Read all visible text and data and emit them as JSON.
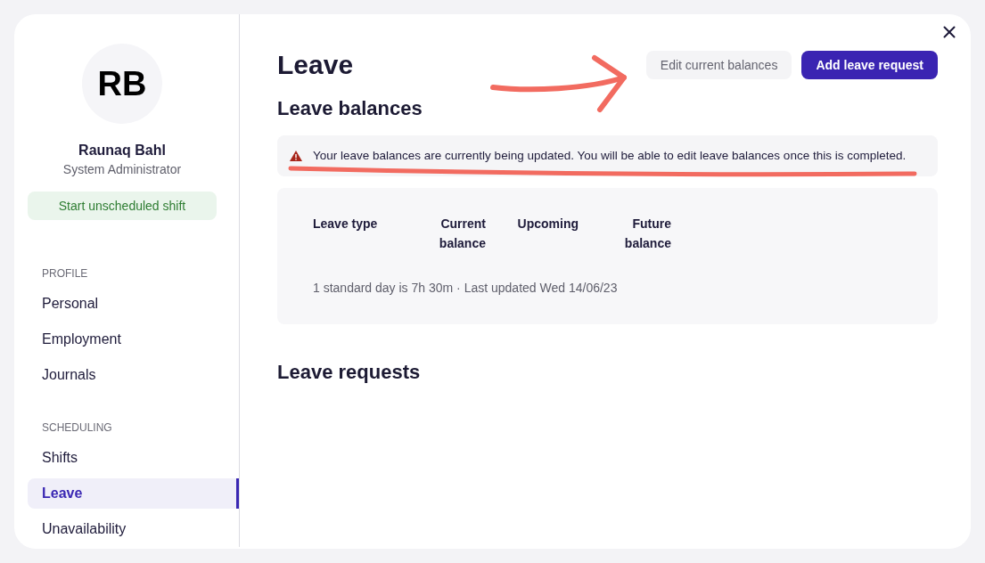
{
  "profile": {
    "initials": "RB",
    "name": "Raunaq Bahl",
    "role": "System Administrator",
    "action_button": "Start unscheduled shift"
  },
  "sidebar": {
    "sections": [
      {
        "heading": "PROFILE",
        "items": [
          {
            "label": "Personal",
            "selected": false
          },
          {
            "label": "Employment",
            "selected": false
          },
          {
            "label": "Journals",
            "selected": false
          }
        ]
      },
      {
        "heading": "SCHEDULING",
        "items": [
          {
            "label": "Shifts",
            "selected": false
          },
          {
            "label": "Leave",
            "selected": true
          },
          {
            "label": "Unavailability",
            "selected": false
          }
        ]
      }
    ]
  },
  "page": {
    "title": "Leave",
    "buttons": [
      {
        "label": "Edit current balances",
        "kind": "secondary",
        "arrow_annotation": true
      },
      {
        "label": "Add leave request",
        "kind": "primary",
        "arrow_annotation": false
      }
    ]
  },
  "leave_balances": {
    "heading": "Leave balances",
    "alert": {
      "kind": "warning",
      "text": "Your leave balances are currently being updated. You will be able to edit leave balances once this is completed.",
      "underline_annotation": true
    },
    "table": {
      "columns": [
        {
          "label": "Leave type",
          "kind": "text"
        },
        {
          "label": "Current balance",
          "kind": "numeric"
        },
        {
          "label": "Upcoming",
          "kind": "numeric"
        },
        {
          "label": "Future balance",
          "kind": "numeric"
        }
      ]
    },
    "footnote": "1 standard day is 7h 30m · Last updated Wed 14/06/23"
  },
  "leave_requests": {
    "heading": "Leave requests"
  }
}
